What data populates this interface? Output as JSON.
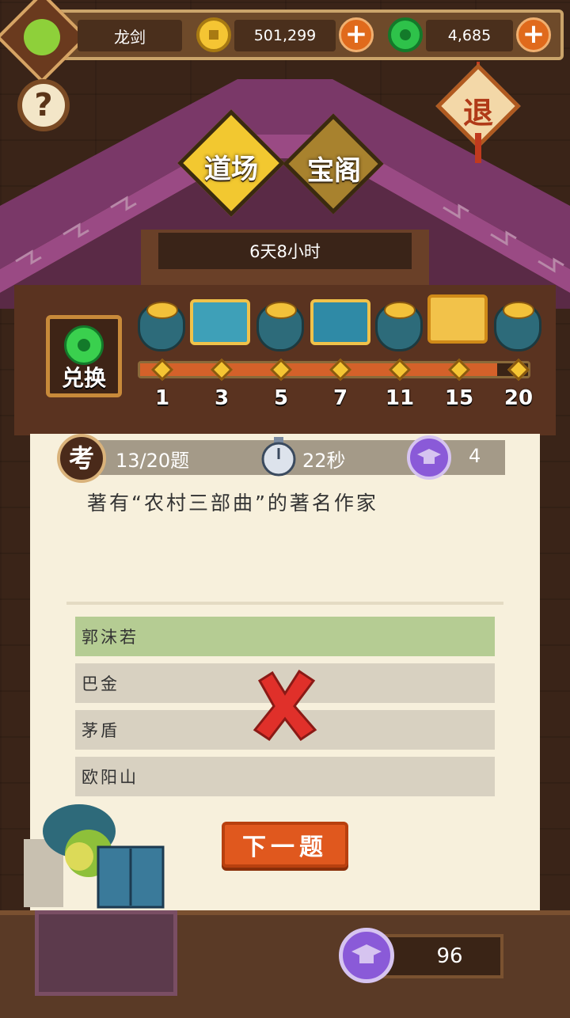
{
  "header": {
    "player_name": "龙剑",
    "coins": "501,299",
    "jade": "4,685",
    "add_symbol": "+"
  },
  "help": {
    "label": "?"
  },
  "exit": {
    "label": "退"
  },
  "tabs": [
    {
      "label": "道场",
      "active": true
    },
    {
      "label": "宝阁",
      "active": false
    }
  ],
  "timer": {
    "text": "6天8小时"
  },
  "exchange": {
    "label": "兑换"
  },
  "rewards": {
    "milestones": [
      "1",
      "3",
      "5",
      "7",
      "11",
      "15",
      "20"
    ],
    "progress": 0.92,
    "icons": [
      "coin-bag-icon",
      "gem-chest-icon",
      "coin-bag-icon",
      "treasure-chest-icon",
      "coin-bag-icon",
      "gold-chest-icon",
      "coin-bag-icon"
    ]
  },
  "quiz": {
    "badge": "考",
    "progress": "13/20题",
    "time_left": "22秒",
    "score": "4",
    "question": "著有“农村三部曲”的著名作家",
    "options": [
      {
        "text": "郭沫若",
        "selected": true
      },
      {
        "text": "巴金",
        "selected": false
      },
      {
        "text": "茅盾",
        "selected": false
      },
      {
        "text": "欧阳山",
        "selected": false
      }
    ],
    "next_button": "下一题"
  },
  "footer": {
    "total_points": "96"
  },
  "colors": {
    "accent_orange": "#e0581e",
    "selected_option": "#b5cc93",
    "wrong_mark": "#e0302a",
    "active_tab": "#f2c830",
    "inactive_tab": "#a8822e"
  }
}
